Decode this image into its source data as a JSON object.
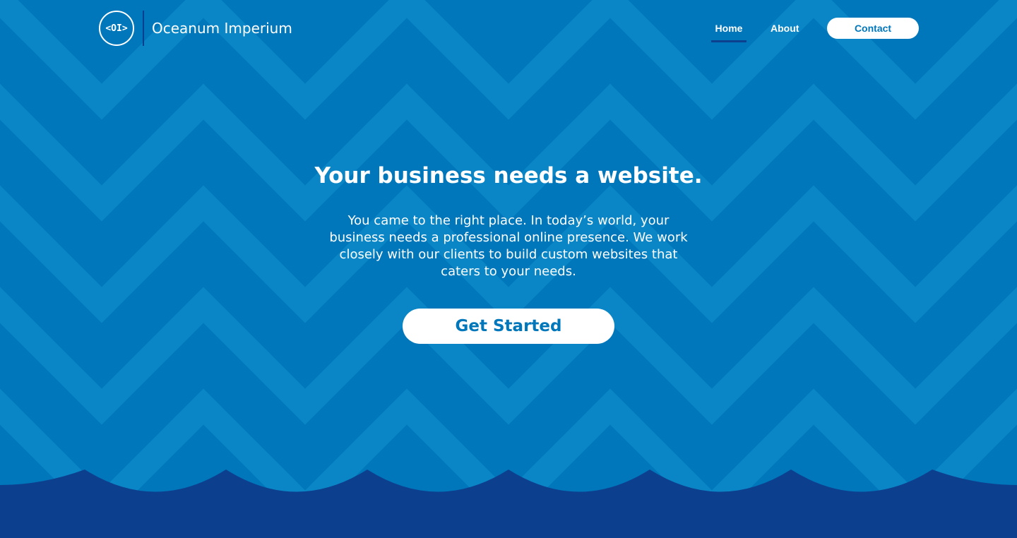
{
  "colors": {
    "background": "#0077bb",
    "chevron": "#0a86c6",
    "wave": "#0d3f8f",
    "accent": "#0d3f8f",
    "button_text": "#0077bb",
    "text": "#ffffff"
  },
  "header": {
    "logo_text": "<OI>",
    "brand_name": "Oceanum Imperium",
    "nav": {
      "home": "Home",
      "about": "About",
      "contact": "Contact",
      "active": "Home"
    }
  },
  "hero": {
    "title": "Your business needs a website.",
    "text": "You came to the right place. In today’s world, your business needs a professional online presence. We work closely with our clients to build custom websites that caters to your needs.",
    "cta_label": "Get Started"
  }
}
